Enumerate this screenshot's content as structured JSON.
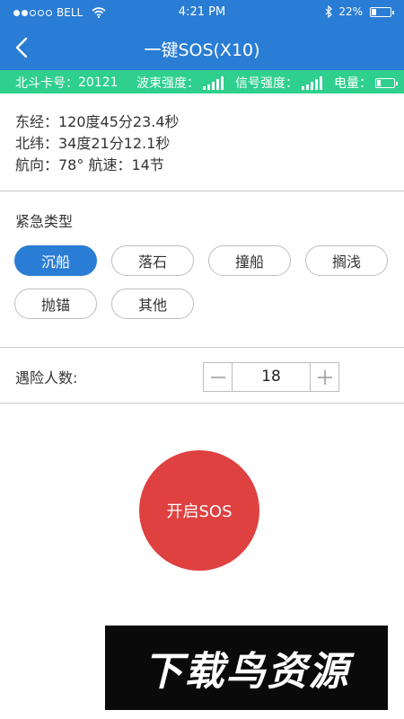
{
  "status_bar": {
    "carrier": "BELL",
    "time": "4:21 PM",
    "battery": "22%",
    "battery_level": 0.22,
    "signal_dots_filled": 2,
    "signal_dots_total": 5
  },
  "nav": {
    "back_icon": "chevron-left-icon",
    "title": "一键SOS(X10)"
  },
  "info_bar": {
    "card_label": "北斗卡号：",
    "card_number": "20121",
    "beam_label": "波束强度：",
    "beam_level": 5,
    "signal_label": "信号强度：",
    "signal_level": 5,
    "power_label": "电量：",
    "power_level": 0.2
  },
  "position": {
    "longitude": "东经：120度45分23.4秒",
    "latitude": "北纬：34度21分12.1秒",
    "heading_speed": "航向：78°  航速：14节"
  },
  "emergency": {
    "title": "紧急类型",
    "selected": "沉船",
    "options": [
      "沉船",
      "落石",
      "撞船",
      "搁浅",
      "抛锚",
      "其他"
    ]
  },
  "people": {
    "label": "遇险人数:",
    "value": "18"
  },
  "sos": {
    "label": "开启SOS",
    "color": "#df4040"
  },
  "watermark": {
    "text": "下载鸟资源"
  },
  "colors": {
    "primary": "#2a7dd4",
    "info_bar": "#2fcf8e"
  }
}
